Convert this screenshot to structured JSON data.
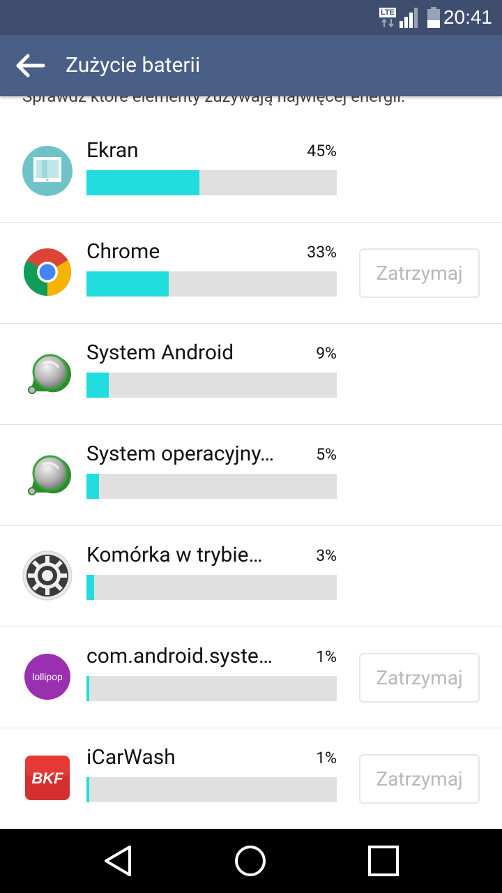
{
  "status_bar": {
    "network_label": "LTE",
    "time": "20:41"
  },
  "app_bar": {
    "title": "Zużycie baterii"
  },
  "subtitle": "Sprawdź które elementy zużywają najwięcej energii.",
  "colors": {
    "status_bar": "#3f4e6e",
    "app_bar": "#4a5f86",
    "usage_fill": "#22dddd",
    "usage_track": "#e0e0e0"
  },
  "apps": [
    {
      "name": "Ekran",
      "percent_label": "45%",
      "usage_fraction": 0.45,
      "icon": "screen-icon",
      "stop_label": ""
    },
    {
      "name": "Chrome",
      "percent_label": "33%",
      "usage_fraction": 0.33,
      "icon": "chrome-icon",
      "stop_label": "Zatrzymaj"
    },
    {
      "name": "System Android",
      "percent_label": "9%",
      "usage_fraction": 0.09,
      "icon": "android-system-icon",
      "stop_label": ""
    },
    {
      "name": "System operacyjny…",
      "percent_label": "5%",
      "usage_fraction": 0.05,
      "icon": "android-system-icon",
      "stop_label": ""
    },
    {
      "name": "Komórka w trybie…",
      "percent_label": "3%",
      "usage_fraction": 0.03,
      "icon": "settings-gear-icon",
      "stop_label": ""
    },
    {
      "name": "com.android.syste…",
      "percent_label": "1%",
      "usage_fraction": 0.01,
      "icon": "lollipop-icon",
      "stop_label": "Zatrzymaj",
      "icon_text": "lollipop"
    },
    {
      "name": "iCarWash",
      "percent_label": "1%",
      "usage_fraction": 0.01,
      "icon": "icarwash-icon",
      "stop_label": "Zatrzymaj",
      "icon_text": "BKF"
    }
  ]
}
